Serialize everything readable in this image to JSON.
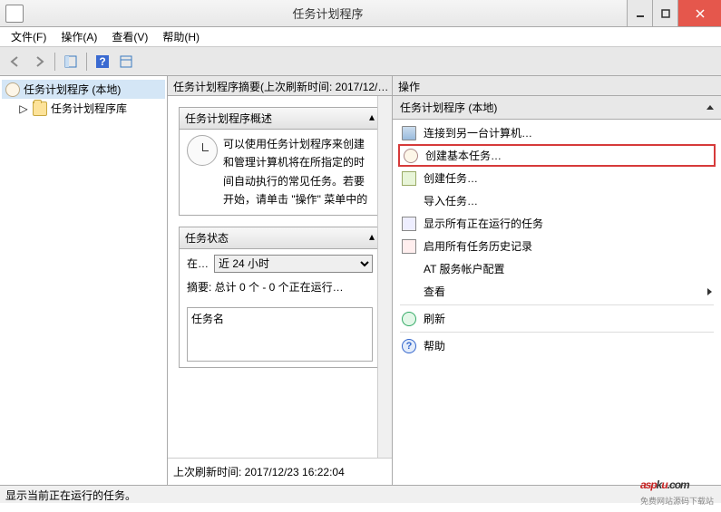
{
  "window": {
    "title": "任务计划程序"
  },
  "menubar": {
    "file": "文件(F)",
    "action": "操作(A)",
    "view": "查看(V)",
    "help": "帮助(H)"
  },
  "tree": {
    "root": "任务计划程序 (本地)",
    "library": "任务计划程序库"
  },
  "middle": {
    "header": "任务计划程序摘要(上次刷新时间: 2017/12/…",
    "overview_title": "任务计划程序概述",
    "overview_text": "可以使用任务计划程序来创建和管理计算机将在所指定的时间自动执行的常见任务。若要开始，请单击 \"操作\" 菜单中的",
    "status_title": "任务状态",
    "status_label": "在…",
    "status_option": "近 24 小时",
    "summary": "摘要: 总计 0 个 - 0 个正在运行…",
    "name_header": "任务名",
    "footer": "上次刷新时间: 2017/12/23 16:22:04"
  },
  "right": {
    "header": "操作",
    "title": "任务计划程序 (本地)",
    "actions": {
      "connect": "连接到另一台计算机…",
      "create_basic": "创建基本任务…",
      "create": "创建任务…",
      "import": "导入任务…",
      "show_running": "显示所有正在运行的任务",
      "enable_history": "启用所有任务历史记录",
      "at_account": "AT 服务帐户配置",
      "view": "查看",
      "refresh": "刷新",
      "help": "帮助"
    }
  },
  "statusbar": {
    "text": "显示当前正在运行的任务。"
  },
  "watermark": {
    "brand_a": "asp",
    "brand_k": "k",
    "brand_u": "u",
    "ext": ".com",
    "sub": "免费网站源码下载站"
  }
}
